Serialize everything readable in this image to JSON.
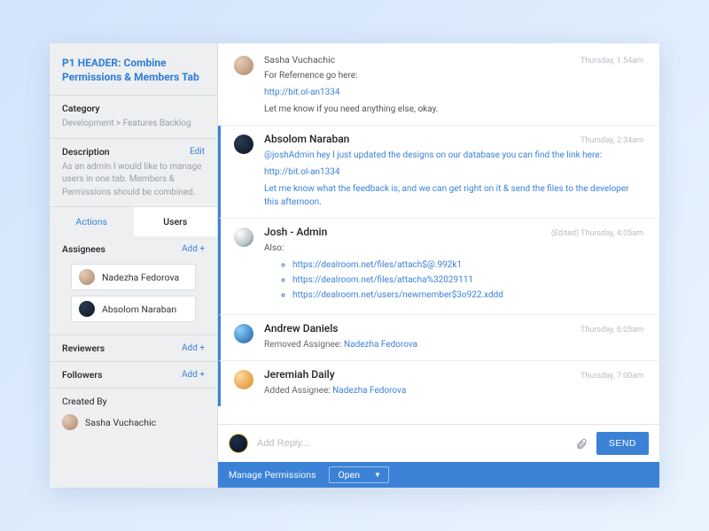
{
  "header": {
    "title": "P1 HEADER: Combine Permissions & Members Tab"
  },
  "category": {
    "label": "Category",
    "path": "Development > Features Backlog"
  },
  "description": {
    "label": "Description",
    "editLabel": "Edit",
    "text": "As an admin I would like to manage users in one tab. Members & Permissions should be combined."
  },
  "tabs": {
    "actions": "Actions",
    "users": "Users"
  },
  "users": {
    "assignees": {
      "label": "Assignees",
      "addLabel": "Add +",
      "items": [
        {
          "name": "Nadezha Fedorova"
        },
        {
          "name": "Absolom Naraban"
        }
      ]
    },
    "reviewers": {
      "label": "Reviewers",
      "addLabel": "Add +"
    },
    "followers": {
      "label": "Followers",
      "addLabel": "Add +"
    }
  },
  "createdBy": {
    "label": "Created By",
    "name": "Sasha Vuchachic"
  },
  "thread": {
    "c0": {
      "author": "Sasha Vuchachic",
      "ts": "Thursday, 1.54am",
      "line1": "For Refernence go here:",
      "link1": "http://bit.ol-an1334",
      "line2": "Let me know if you need anything else, okay."
    },
    "c1": {
      "author": "Absolom Naraban",
      "ts": "Thursday, 2:34am",
      "line1": "@joshAdmin hey I just updated the designs on our database you can find the link here:",
      "link1": "http://bit.ol-an1334",
      "line2": "Let me know what the feedback is, and we can get right on it & send the files to the developer this afternoon."
    },
    "c2": {
      "author": "Josh - Admin",
      "ts": "(Edited) Thursday, 4:05am",
      "line1": "Also:",
      "links": [
        "https://dealroom.net/files/attach$@.992k1",
        "https://dealroom.net/files/attacha%32029111",
        "https://dealroom.net/users/newmember$3o922.xddd"
      ]
    },
    "c3": {
      "author": "Andrew Daniels",
      "ts": "Thursday, 6:05am",
      "action": "Removed Assignee: ",
      "target": "Nadezha Fedorova"
    },
    "c4": {
      "author": "Jeremiah Daily",
      "ts": "Thursday, 7:00am",
      "action": "Added Assignee: ",
      "target": "Nadezha Fedorova"
    }
  },
  "reply": {
    "placeholder": "Add Reply...",
    "sendLabel": "SEND"
  },
  "footer": {
    "label": "Manage Permissions",
    "value": "Open"
  }
}
